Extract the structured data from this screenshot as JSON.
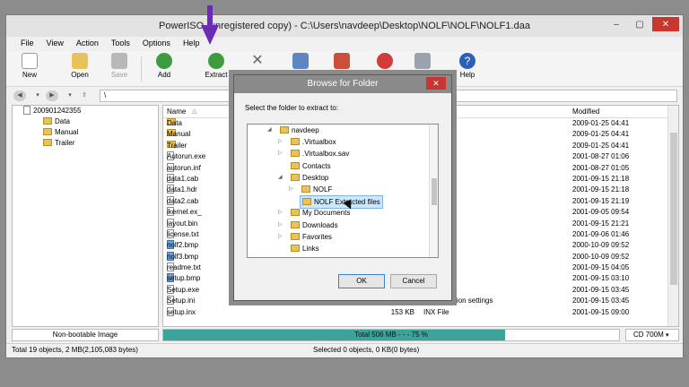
{
  "window": {
    "title": "PowerISO (unregistered copy) - C:\\Users\\navdeep\\Desktop\\NOLF\\NOLF\\NOLF1.daa",
    "controls": [
      "–",
      "▢",
      "✕"
    ]
  },
  "menu": [
    "File",
    "View",
    "Action",
    "Tools",
    "Options",
    "Help"
  ],
  "toolbar": {
    "new_label": "New",
    "open_label": "Open",
    "save_label": "Save",
    "add_label": "Add",
    "extract_label": "Extract",
    "help_label": "Help"
  },
  "address": {
    "path": "\\"
  },
  "tree": {
    "root": "200901242355",
    "children": [
      "Data",
      "Manual",
      "Trailer"
    ]
  },
  "list": {
    "headers": {
      "name": "Name",
      "modified": "Modified"
    },
    "rows": [
      {
        "name": "Data",
        "size": "",
        "type": "",
        "modified": "2009-01-25 04:41",
        "kind": "folder"
      },
      {
        "name": "Manual",
        "size": "",
        "type": "",
        "modified": "2009-01-25 04:41",
        "kind": "folder"
      },
      {
        "name": "Trailer",
        "size": "",
        "type": "",
        "modified": "2009-01-25 04:41",
        "kind": "folder"
      },
      {
        "name": "Autorun.exe",
        "size": "",
        "type": "",
        "modified": "2001-08-27 01:06",
        "kind": "file"
      },
      {
        "name": "autorun.inf",
        "size": "",
        "type": "nation",
        "modified": "2001-08-27 01:05",
        "kind": "file"
      },
      {
        "name": "data1.cab",
        "size": "",
        "type": "",
        "modified": "2001-09-15 21:18",
        "kind": "file"
      },
      {
        "name": "data1.hdr",
        "size": "",
        "type": "",
        "modified": "2001-09-15 21:18",
        "kind": "file"
      },
      {
        "name": "data2.cab",
        "size": "",
        "type": "",
        "modified": "2001-09-15 21:19",
        "kind": "file"
      },
      {
        "name": "ikernel.ex_",
        "size": "",
        "type": "",
        "modified": "2001-09-05 09:54",
        "kind": "file"
      },
      {
        "name": "layout.bin",
        "size": "",
        "type": "",
        "modified": "2001-09-15 21:21",
        "kind": "file"
      },
      {
        "name": "license.txt",
        "size": "",
        "type": "ent",
        "modified": "2001-09-06 01:46",
        "kind": "file"
      },
      {
        "name": "nolf2.bmp",
        "size": "",
        "type": "",
        "modified": "2000-10-09 09:52",
        "kind": "image"
      },
      {
        "name": "nolf3.bmp",
        "size": "",
        "type": "",
        "modified": "2000-10-09 09:52",
        "kind": "image"
      },
      {
        "name": "readme.txt",
        "size": "",
        "type": "ent",
        "modified": "2001-09-15 04:05",
        "kind": "file"
      },
      {
        "name": "setup.bmp",
        "size": "",
        "type": "",
        "modified": "2001-09-15 03:10",
        "kind": "image"
      },
      {
        "name": "Setup.exe",
        "size": "",
        "type": "",
        "modified": "2001-09-15 03:45",
        "kind": "file"
      },
      {
        "name": "Setup.ini",
        "size": "1 KB",
        "type": "Configuration settings",
        "modified": "2001-09-15 03:45",
        "kind": "file"
      },
      {
        "name": "setup.inx",
        "size": "153 KB",
        "type": "INX File",
        "modified": "2001-09-15 09:00",
        "kind": "file"
      }
    ]
  },
  "status": {
    "image_type": "Non-bootable Image",
    "progress_text": "Total  506 MB   - - -  75 %",
    "progress_fraction": 0.75,
    "media": "CD 700M",
    "left": "Total 19 objects, 2 MB(2,105,083 bytes)",
    "right": "Selected 0 objects, 0 KB(0 bytes)"
  },
  "dialog": {
    "title": "Browse for Folder",
    "prompt": "Select the folder to extract to:",
    "items": [
      {
        "label": "navdeep",
        "indent": 0,
        "arrow": "◢",
        "selected": false
      },
      {
        "label": ".Virtualbox",
        "indent": 1,
        "arrow": "▷",
        "selected": false
      },
      {
        "label": ".Virtualbox.sav",
        "indent": 1,
        "arrow": "▷",
        "selected": false
      },
      {
        "label": "Contacts",
        "indent": 1,
        "arrow": "",
        "selected": false
      },
      {
        "label": "Desktop",
        "indent": 1,
        "arrow": "◢",
        "selected": false
      },
      {
        "label": "NOLF",
        "indent": 2,
        "arrow": "▷",
        "selected": false
      },
      {
        "label": "NOLF Extracted files",
        "indent": 2,
        "arrow": "",
        "selected": true
      },
      {
        "label": "My Documents",
        "indent": 1,
        "arrow": "▷",
        "selected": false
      },
      {
        "label": "Downloads",
        "indent": 1,
        "arrow": "▷",
        "selected": false
      },
      {
        "label": "Favorites",
        "indent": 1,
        "arrow": "▷",
        "selected": false
      },
      {
        "label": "Links",
        "indent": 1,
        "arrow": "",
        "selected": false
      }
    ],
    "ok_label": "OK",
    "cancel_label": "Cancel"
  },
  "colors": {
    "progress": "#3aa39a",
    "close": "#c7372f",
    "annotation_arrow": "#6a2bb5"
  }
}
